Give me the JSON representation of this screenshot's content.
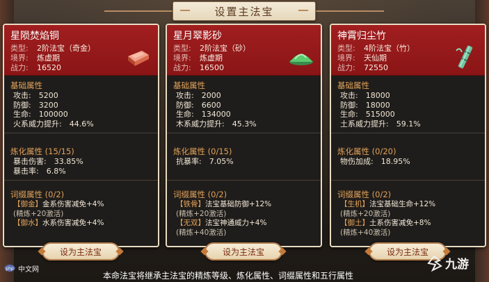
{
  "title": "设置主法宝",
  "cards": [
    {
      "name": "星陨焚焰铜",
      "info": [
        {
          "key": "类型:",
          "value": "2阶法宝（奇金）"
        },
        {
          "key": "境界:",
          "value": "炼虚期"
        },
        {
          "key": "战力:",
          "value": "16520"
        }
      ],
      "icon": "copper-ingot-icon",
      "icon_color": "#d9684a",
      "base_title": "基础属性",
      "base": [
        "攻击:　5200",
        "防御:　3200",
        "生命:　100000",
        "火系威力提升:　44.6%"
      ],
      "refine_title": "炼化属性 (15/15)",
      "refine": [
        "暴击伤害:　33.85%",
        "暴击率:　6.8%"
      ],
      "affix_title": "词缀属性 (0/2)",
      "affixes": [
        {
          "tag": "【御金】",
          "text": "金系伤害减免+4%",
          "sub": "(精炼+20激活)"
        },
        {
          "tag": "【御水】",
          "text": "水系伤害减免+4%",
          "sub": ""
        }
      ],
      "button": "设为主法宝"
    },
    {
      "name": "星月翠影砂",
      "info": [
        {
          "key": "类型:",
          "value": "2阶法宝（砂）"
        },
        {
          "key": "境界:",
          "value": "炼虚期"
        },
        {
          "key": "战力:",
          "value": "16500"
        }
      ],
      "icon": "green-sand-pile-icon",
      "icon_color": "#4fb865",
      "base_title": "基础属性",
      "base": [
        "攻击:　2000",
        "防御:　6600",
        "生命:　134000",
        "木系威力提升:　45.3%"
      ],
      "refine_title": "炼化属性 (0/15)",
      "refine": [
        "抗暴率:　7.05%"
      ],
      "affix_title": "词缀属性 (0/2)",
      "affixes": [
        {
          "tag": "【铁骨】",
          "text": "法宝基础防御+12%",
          "sub": "(精炼+20激活)"
        },
        {
          "tag": "【无双】",
          "text": "法宝神通威力+4%",
          "sub": "(精炼+40激活)"
        }
      ],
      "button": "设为主法宝"
    },
    {
      "name": "神霄归尘竹",
      "info": [
        {
          "key": "类型:",
          "value": "4阶法宝（竹）"
        },
        {
          "key": "境界:",
          "value": "天仙期"
        },
        {
          "key": "战力:",
          "value": "72550"
        }
      ],
      "icon": "bamboo-icon",
      "icon_color": "#59b08f",
      "base_title": "基础属性",
      "base": [
        "攻击:　18000",
        "防御:　18000",
        "生命:　515000",
        "土系威力提升:　59.1%"
      ],
      "refine_title": "炼化属性 (0/20)",
      "refine": [
        "物伤加成:　18.95%"
      ],
      "affix_title": "词缀属性 (0/2)",
      "affixes": [
        {
          "tag": "【生机】",
          "text": "法宝基础生命+12%",
          "sub": "(精炼+20激活)"
        },
        {
          "tag": "【御土】",
          "text": "土系伤害减免+8%",
          "sub": "(精炼+40激活)"
        }
      ],
      "button": "设为主法宝"
    }
  ],
  "footer": "本命法宝将继承主法宝的精炼等级、炼化属性、词缀属性和五行属性",
  "watermark_left": "中文网",
  "watermark_right": "九游"
}
